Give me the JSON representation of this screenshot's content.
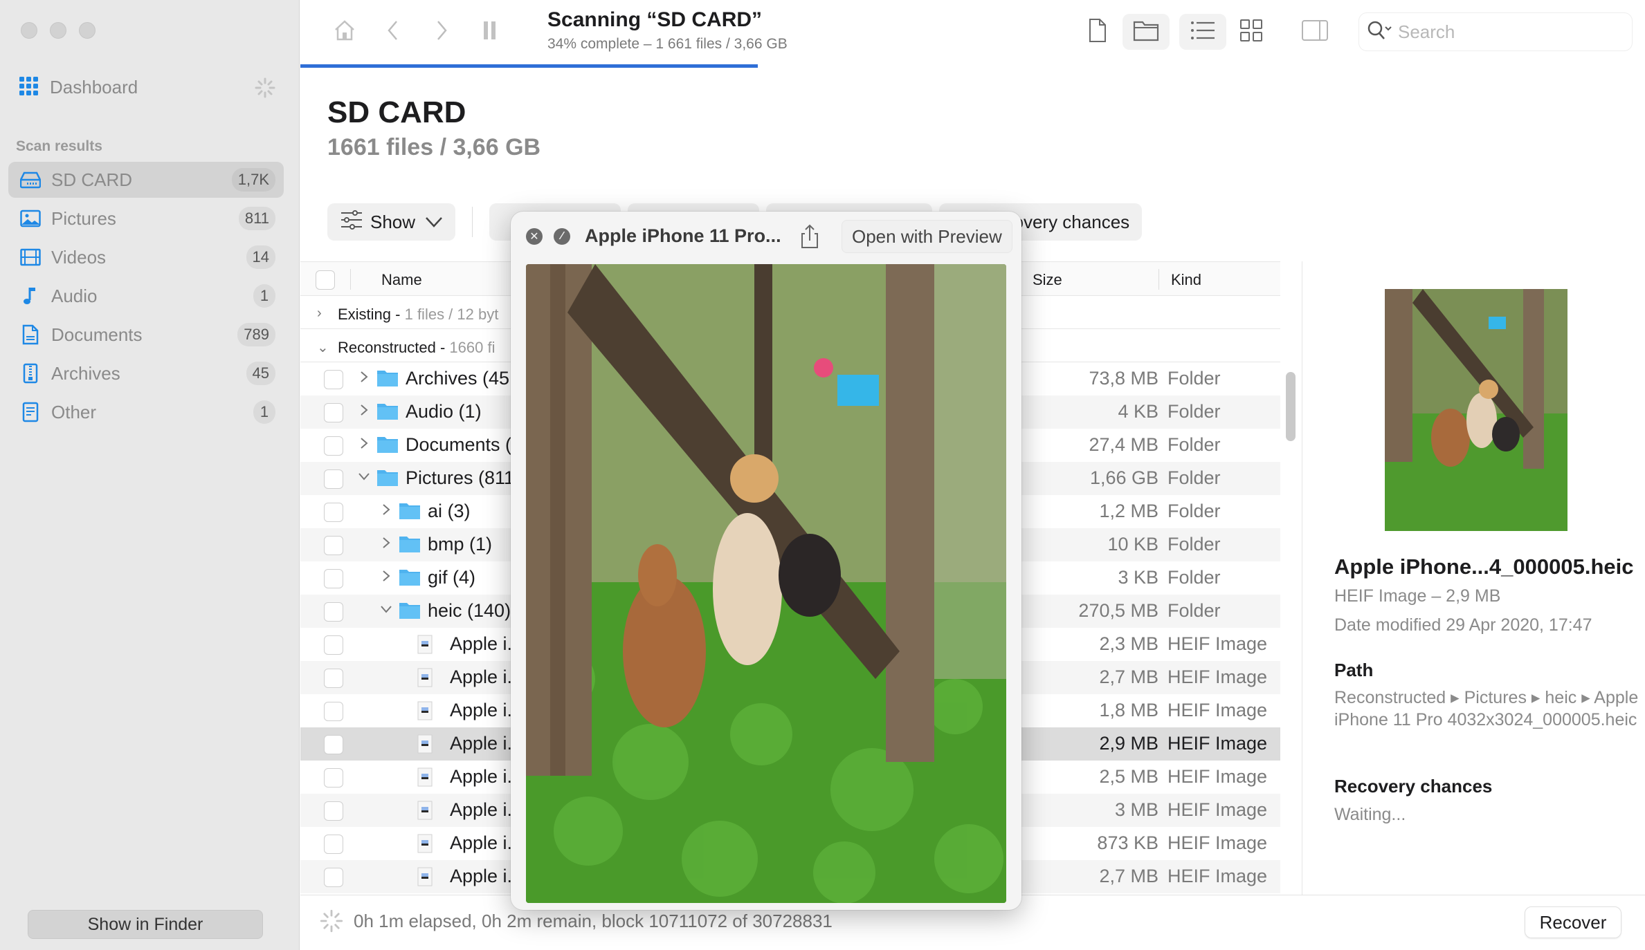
{
  "window": {
    "traffic_lights": [
      "close",
      "minimize",
      "zoom"
    ]
  },
  "sidebar": {
    "dashboard_label": "Dashboard",
    "section_title": "Scan results",
    "items": [
      {
        "label": "SD CARD",
        "count": "1,7K",
        "icon": "drive-icon",
        "active": true
      },
      {
        "label": "Pictures",
        "count": "811",
        "icon": "picture-icon",
        "active": false
      },
      {
        "label": "Videos",
        "count": "14",
        "icon": "film-icon",
        "active": false
      },
      {
        "label": "Audio",
        "count": "1",
        "icon": "music-note-icon",
        "active": false
      },
      {
        "label": "Documents",
        "count": "789",
        "icon": "document-icon",
        "active": false
      },
      {
        "label": "Archives",
        "count": "45",
        "icon": "archive-icon",
        "active": false
      },
      {
        "label": "Other",
        "count": "1",
        "icon": "other-file-icon",
        "active": false
      }
    ],
    "show_in_finder_label": "Show in Finder"
  },
  "toolbar": {
    "scan_title": "Scanning “SD CARD”",
    "scan_subtitle": "34% complete – 1 661 files / 3,66 GB",
    "progress_percent": 34,
    "search_placeholder": "Search"
  },
  "main": {
    "title": "SD CARD",
    "subtitle": "1661 files / 3,66 GB",
    "filters": {
      "show_label": "Show",
      "recovery_chances_label": "ecovery chances"
    },
    "table": {
      "columns": {
        "name": "Name",
        "size": "Size",
        "kind": "Kind"
      },
      "groups": [
        {
          "label": "Existing - ",
          "detail": "1 files / 12 byt",
          "expanded": false
        },
        {
          "label": "Reconstructed - ",
          "detail": "1660 fi",
          "expanded": true
        }
      ],
      "rows": [
        {
          "name": "Archives (45",
          "size": "73,8 MB",
          "kind": "Folder",
          "level": 0,
          "type": "folder",
          "expanded": false
        },
        {
          "name": "Audio (1)",
          "size": "4 KB",
          "kind": "Folder",
          "level": 0,
          "type": "folder",
          "expanded": false
        },
        {
          "name": "Documents (",
          "size": "27,4 MB",
          "kind": "Folder",
          "level": 0,
          "type": "folder",
          "expanded": false
        },
        {
          "name": "Pictures (811",
          "size": "1,66 GB",
          "kind": "Folder",
          "level": 0,
          "type": "folder",
          "expanded": true
        },
        {
          "name": "ai (3)",
          "size": "1,2 MB",
          "kind": "Folder",
          "level": 1,
          "type": "folder",
          "expanded": false
        },
        {
          "name": "bmp (1)",
          "size": "10 KB",
          "kind": "Folder",
          "level": 1,
          "type": "folder",
          "expanded": false
        },
        {
          "name": "gif (4)",
          "size": "3 KB",
          "kind": "Folder",
          "level": 1,
          "type": "folder",
          "expanded": false
        },
        {
          "name": "heic (140)",
          "size": "270,5 MB",
          "kind": "Folder",
          "level": 1,
          "type": "folder",
          "expanded": true
        },
        {
          "name": "Apple i.",
          "size": "2,3 MB",
          "kind": "HEIF Image",
          "level": 2,
          "type": "file"
        },
        {
          "name": "Apple i.",
          "size": "2,7 MB",
          "kind": "HEIF Image",
          "level": 2,
          "type": "file"
        },
        {
          "name": "Apple i.",
          "size": "1,8 MB",
          "kind": "HEIF Image",
          "level": 2,
          "type": "file"
        },
        {
          "name": "Apple i.",
          "size": "2,9 MB",
          "kind": "HEIF Image",
          "level": 2,
          "type": "file",
          "selected": true
        },
        {
          "name": "Apple i.",
          "size": "2,5 MB",
          "kind": "HEIF Image",
          "level": 2,
          "type": "file"
        },
        {
          "name": "Apple i.",
          "size": "3 MB",
          "kind": "HEIF Image",
          "level": 2,
          "type": "file"
        },
        {
          "name": "Apple i.",
          "size": "873 KB",
          "kind": "HEIF Image",
          "level": 2,
          "type": "file"
        },
        {
          "name": "Apple i.",
          "size": "2,7 MB",
          "kind": "HEIF Image",
          "level": 2,
          "type": "file"
        }
      ]
    }
  },
  "detail": {
    "file_name": "Apple iPhone...4_000005.heic",
    "type_size": "HEIF Image – 2,9 MB",
    "date_label": "Date modified",
    "date_value": "29 Apr 2020, 17:47",
    "path_heading": "Path",
    "path_value": "Reconstructed ▸ Pictures ▸ heic ▸ Apple iPhone 11 Pro 4032x3024_000005.heic",
    "recovery_heading": "Recovery chances",
    "recovery_value": "Waiting..."
  },
  "quicklook": {
    "title": "Apple iPhone 11 Pro...",
    "open_with_label": "Open with Preview"
  },
  "statusbar": {
    "text": "0h 1m elapsed, 0h 2m remain, block 10711072 of 30728831",
    "recover_label": "Recover"
  },
  "colors": {
    "accent": "#2f6fd7",
    "folder": "#4fb3ef",
    "sidebar_icon": "#1e88e5"
  }
}
